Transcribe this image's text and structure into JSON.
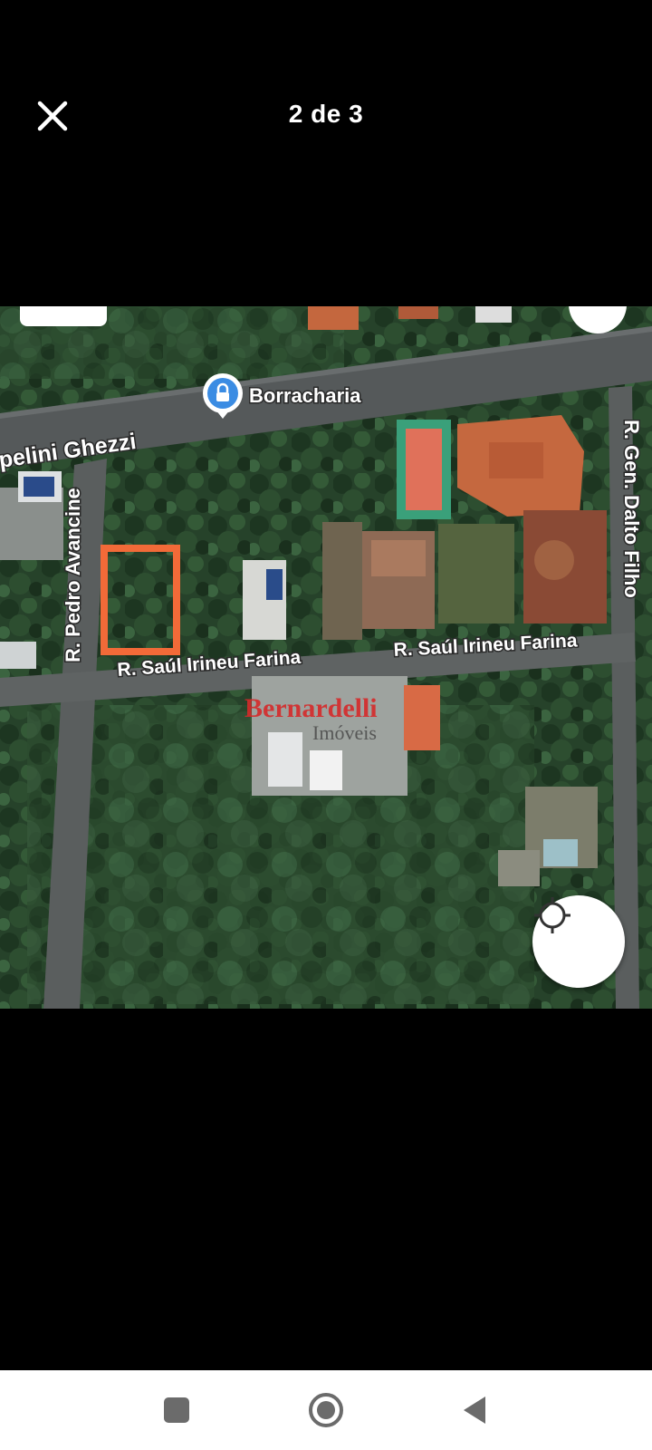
{
  "header": {
    "close_icon": "close-icon",
    "counter": "2 de 3"
  },
  "map": {
    "poi_label": "Borracharia",
    "poi_icon": "lock-pin-icon",
    "streets": {
      "top_diagonal": "pelini Ghezzi",
      "left_vertical": "R. Pedro Avancine",
      "right_vertical": "R. Gen. Dalto Filho",
      "middle_left": "R. Saúl Irineu Farina",
      "middle_right": "R. Saúl Irineu Farina"
    },
    "watermark": {
      "brand": "Bernardelli",
      "sub": "Imóveis"
    },
    "highlight_color": "#f26a38",
    "locate_icon": "gps-locate-icon"
  },
  "navbar": {
    "recents_icon": "square-recents-icon",
    "home_icon": "circle-home-icon",
    "back_icon": "triangle-back-icon"
  }
}
